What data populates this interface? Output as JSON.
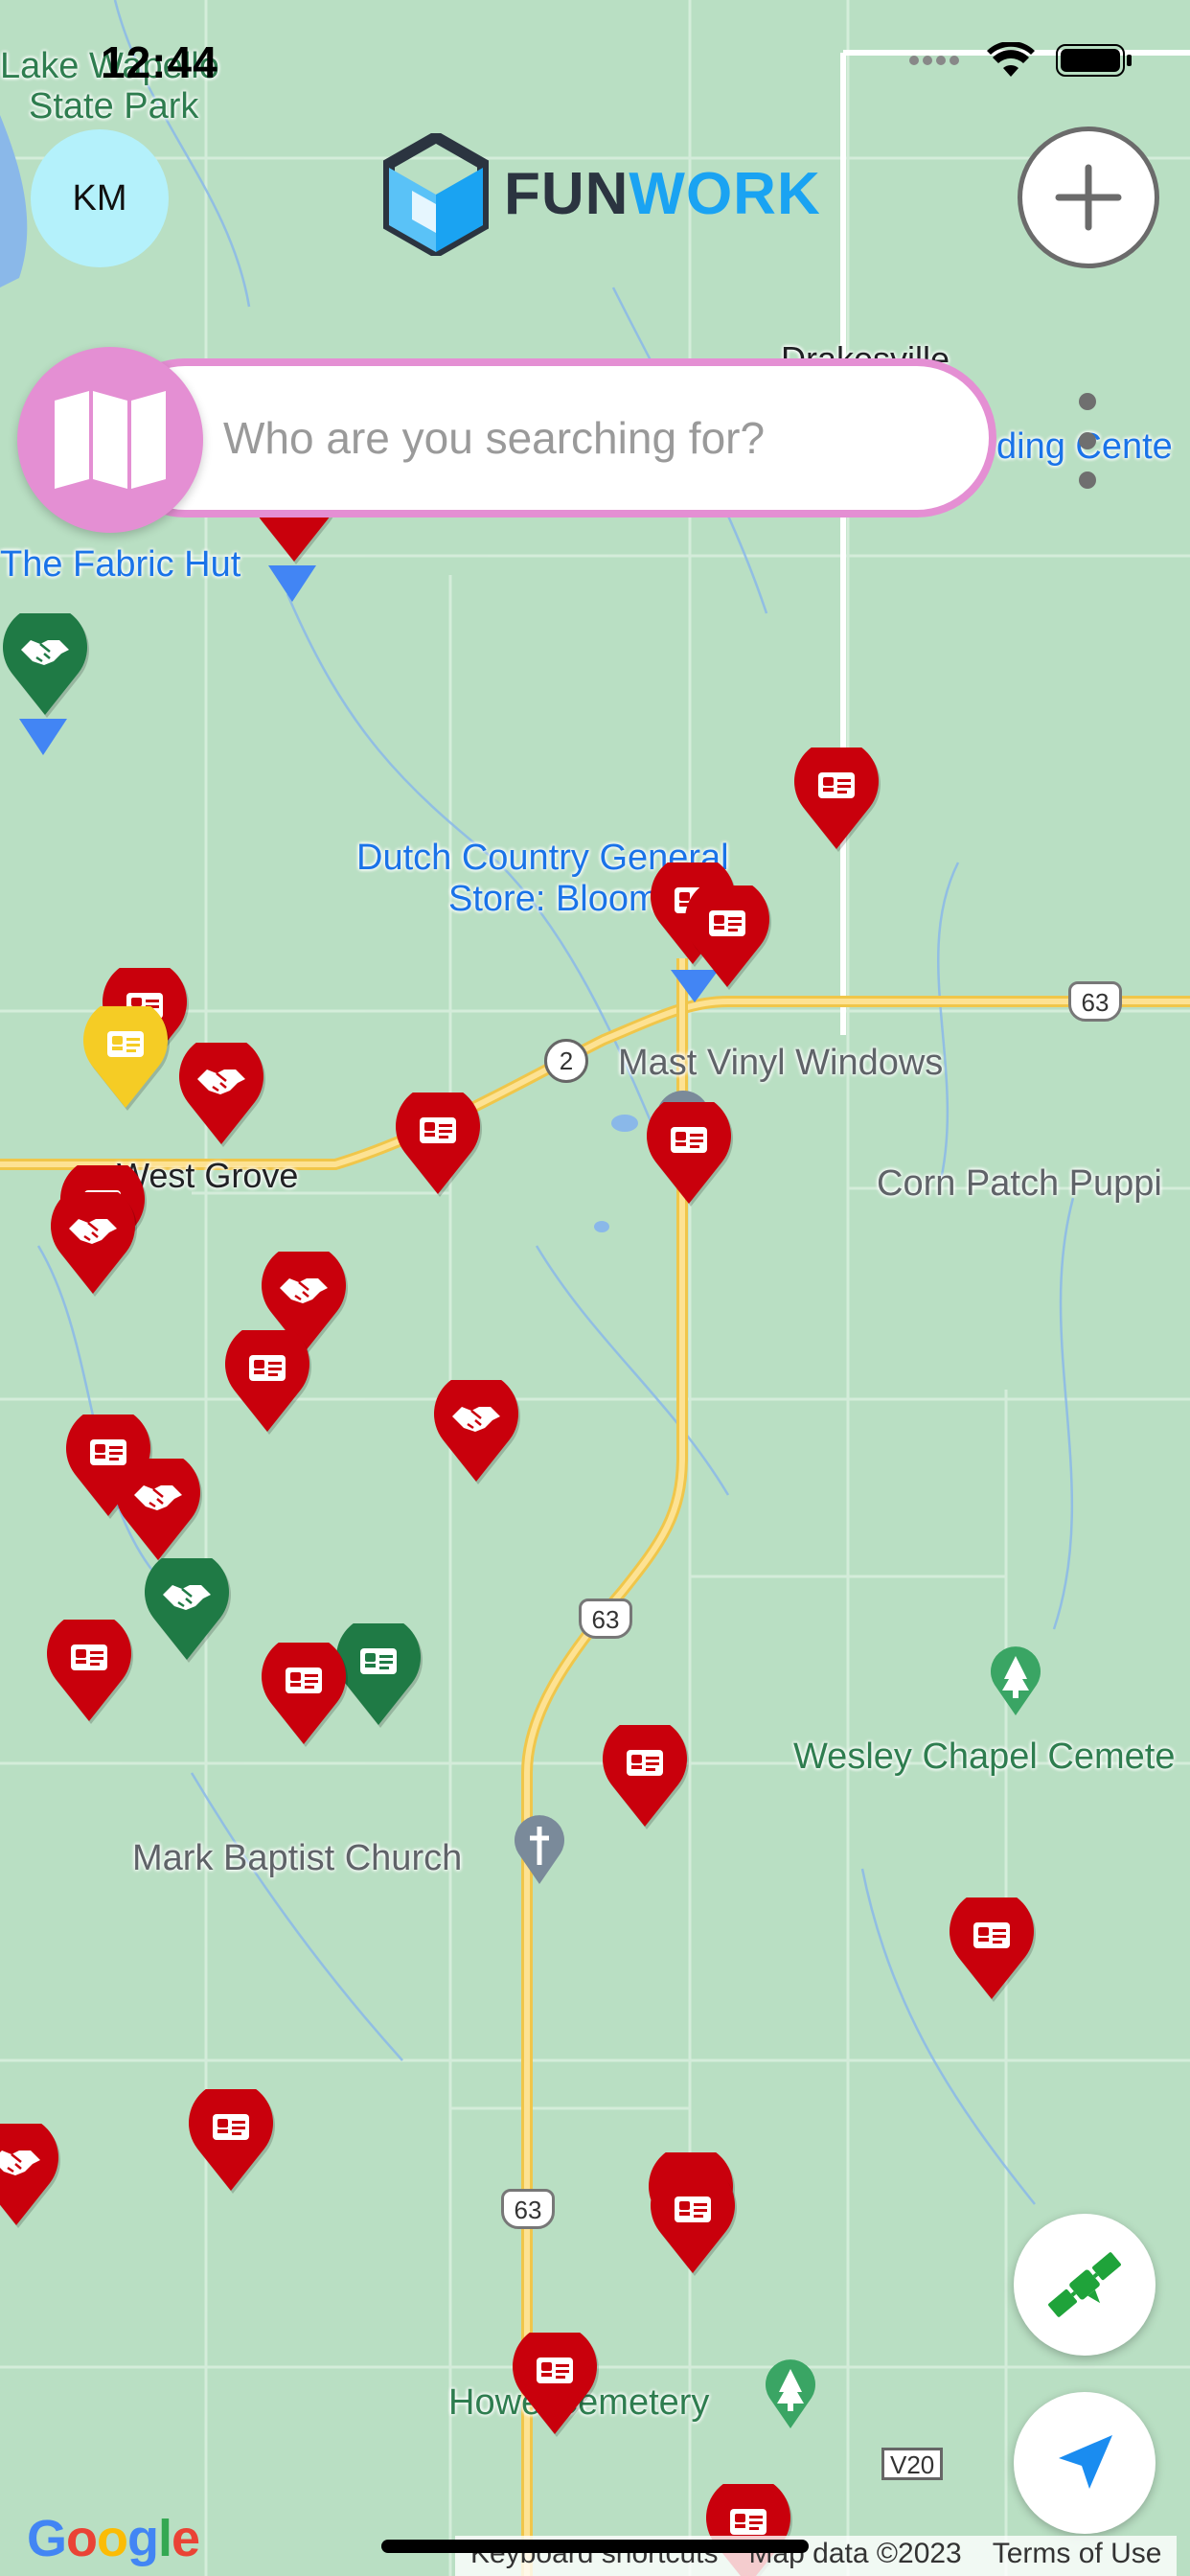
{
  "status_bar": {
    "time": "12:44"
  },
  "header": {
    "avatar_initials": "KM",
    "logo_part1": "FUN",
    "logo_part2": "WORK",
    "add_icon": "plus-icon"
  },
  "search": {
    "placeholder": "Who are you searching for?",
    "value": "",
    "left_icon": "map-icon",
    "menu_icon": "more-vertical-icon"
  },
  "map": {
    "labels": {
      "lake_park_1": "Lake Wapello",
      "lake_park_2": "State Park",
      "drakesville": "Drakesville",
      "building_center": "ding Cente",
      "fabric_hut": "The Fabric Hut",
      "dutch_country_1": "Dutch Country General",
      "dutch_country_2": "Store: Bloomfield",
      "mast_vinyl": "Mast Vinyl Windows",
      "west_grove": "West Grove",
      "corn_patch": "Corn Patch Puppi",
      "wesley_chapel": "Wesley Chapel Cemete",
      "mark_baptist": "Mark Baptist Church",
      "howe_cemetery": "Howe Cemetery"
    },
    "route_signs": {
      "hwy63_a": "63",
      "hwy63_b": "63",
      "hwy63_c": "63",
      "route2": "2",
      "v20": "V20"
    },
    "pin_colors": {
      "red": "#c9000c",
      "green": "#1f7a45",
      "yellow": "#f5cc25"
    },
    "pin_icons": {
      "card": "id-card-icon",
      "handshake": "handshake-icon"
    }
  },
  "controls": {
    "satellite_icon": "satellite-icon",
    "location_icon": "navigation-arrow-icon"
  },
  "footer": {
    "google": "Google",
    "keyboard_shortcuts": "Keyboard shortcuts",
    "map_data": "Map data ©2023",
    "terms": "Terms of Use"
  },
  "colors": {
    "accent_pink": "#e48fd3",
    "avatar_bg": "#b4f1fb",
    "brand_blue": "#1aa3f2",
    "brand_dark": "#2b3440",
    "map_bg": "#b9dfc3"
  }
}
